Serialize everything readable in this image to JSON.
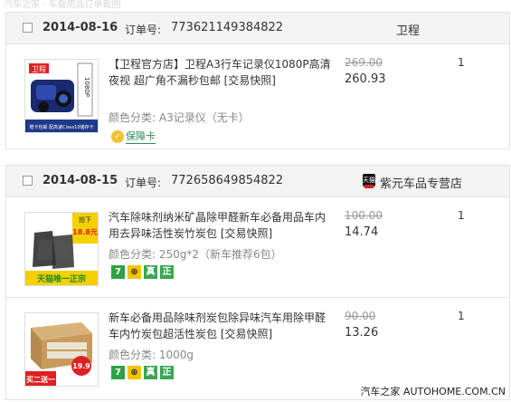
{
  "header_strip_text": "汽车之家 · 车载用品订单截图",
  "orders": [
    {
      "date": "2014-08-16",
      "order_label": "订单号:",
      "order_no": "773621149384822",
      "shop": "卫程",
      "items": [
        {
          "title": "【卫程官方店】卫程A3行车记录仪1080P高清夜视 超广角不漏秒包邮 [交易快照]",
          "variant": "颜色分类: A3记录仪（无卡）",
          "badge": "保障卡",
          "badge_icon": "shield-icon",
          "price_old": "269.00",
          "price": "260.93",
          "qty": "1"
        }
      ]
    },
    {
      "date": "2014-08-15",
      "order_label": "订单号:",
      "order_no": "772658649854822",
      "shop": "紫元车品专营店",
      "shop_icon": "天猫",
      "items": [
        {
          "title": "汽车除味剂纳米矿晶除甲醛新车必备用品车内用去异味活性炭竹炭包 [交易快照]",
          "variant": "颜色分类: 250g*2（新车推荐6包）",
          "services": [
            "7",
            "⊕",
            "真",
            "正"
          ],
          "price_old": "100.00",
          "price": "14.74",
          "qty": "1"
        },
        {
          "title": "新车必备用品除味剂炭包除异味汽车用除甲醛车内竹炭包超活性炭包 [交易快照]",
          "variant": "颜色分类: 1000g",
          "services": [
            "7",
            "⊕",
            "真",
            "正"
          ],
          "price_old": "90.00",
          "price": "13.26",
          "qty": "1"
        }
      ]
    }
  ],
  "thumb_labels": {
    "item1_logo": "卫程",
    "item1_side": "1080P",
    "item1_bottom": "赠卡包邮 配高速Class10储存卡",
    "item2_promo": "拍下",
    "item2_price": "18.8元",
    "item2_banner": "天猫唯一正宗",
    "item3_price": "19.9",
    "item3_banner": "买二送一"
  },
  "watermark": "汽车之家 AUTOHOME.COM.CN",
  "colors": {
    "header_bg": "#f3f3f3",
    "border": "#e3e3e3",
    "old_price": "#999999",
    "variant_text": "#888888",
    "tmall_red": "#e02020"
  }
}
